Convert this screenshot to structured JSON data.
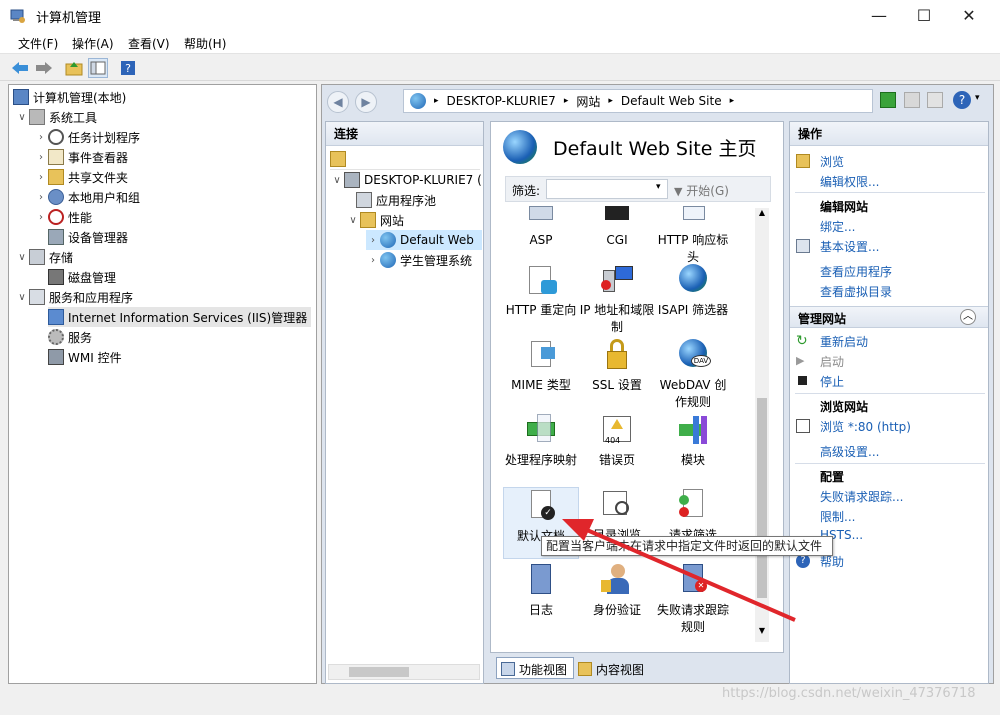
{
  "window": {
    "title": "计算机管理",
    "min": "—",
    "max": "☐",
    "close": "✕"
  },
  "menu": [
    "文件(F)",
    "操作(A)",
    "查看(V)",
    "帮助(H)"
  ],
  "tree": [
    {
      "label": "计算机管理(本地)"
    },
    {
      "label": "系统工具"
    },
    {
      "label": "任务计划程序"
    },
    {
      "label": "事件查看器"
    },
    {
      "label": "共享文件夹"
    },
    {
      "label": "本地用户和组"
    },
    {
      "label": "性能"
    },
    {
      "label": "设备管理器"
    },
    {
      "label": "存储"
    },
    {
      "label": "磁盘管理"
    },
    {
      "label": "服务和应用程序"
    },
    {
      "label": "Internet Information Services (IIS)管理器"
    },
    {
      "label": "服务"
    },
    {
      "label": "WMI 控件"
    }
  ],
  "address": {
    "parts": [
      "DESKTOP-KLURIE7",
      "网站",
      "Default Web Site"
    ],
    "sep": "▸"
  },
  "connections": {
    "title": "连接",
    "nodes": [
      "DESKTOP-KLURIE7 (",
      "应用程序池",
      "网站",
      "Default Web",
      "学生管理系统"
    ]
  },
  "center": {
    "title": "Default Web Site 主页",
    "filter_label": "筛选:",
    "start_label": "开始(G)",
    "icons": [
      {
        "label": "ASP"
      },
      {
        "label": "CGI"
      },
      {
        "label": "HTTP 响应标头"
      },
      {
        "label": "HTTP 重定向"
      },
      {
        "label": "IP 地址和域限制"
      },
      {
        "label": "ISAPI 筛选器"
      },
      {
        "label": "MIME 类型"
      },
      {
        "label": "SSL 设置"
      },
      {
        "label": "WebDAV 创作规则"
      },
      {
        "label": "处理程序映射"
      },
      {
        "label": "错误页"
      },
      {
        "label": "模块"
      },
      {
        "label": "默认文档"
      },
      {
        "label": "目录浏览"
      },
      {
        "label": "请求筛选"
      },
      {
        "label": "日志"
      },
      {
        "label": "身份验证"
      },
      {
        "label": "失败请求跟踪规则"
      }
    ],
    "tab_features": "功能视图",
    "tab_content": "内容视图"
  },
  "tooltip": "配置当客户端未在请求中指定文件时返回的默认文件",
  "actions": {
    "title": "操作",
    "browse": "浏览",
    "edit_perms": "编辑权限...",
    "edit_site": "编辑网站",
    "bindings": "绑定...",
    "basic_settings": "基本设置...",
    "view_apps": "查看应用程序",
    "view_vdirs": "查看虚拟目录",
    "manage_site": "管理网站",
    "restart": "重新启动",
    "start": "启动",
    "stop": "停止",
    "browse_site": "浏览网站",
    "browse_80": "浏览 *:80 (http)",
    "advanced": "高级设置...",
    "config": "配置",
    "failed_trace": "失败请求跟踪...",
    "limits": "限制...",
    "hsts": "HSTS...",
    "help": "帮助"
  },
  "watermark": "https://blog.csdn.net/weixin_47376718"
}
